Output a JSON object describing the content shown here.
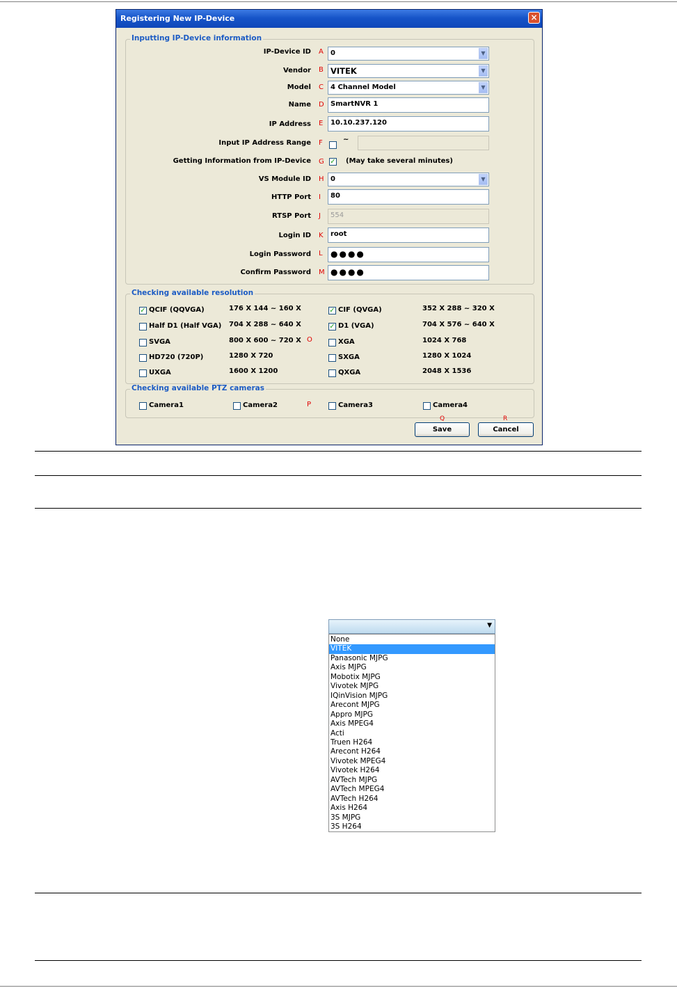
{
  "dialog": {
    "title": "Registering New IP-Device",
    "close_glyph": "×",
    "groups": {
      "info": "Inputting IP-Device information",
      "resolution": "Checking available resolution",
      "ptz": "Checking available PTZ cameras"
    },
    "fields": {
      "device_id": {
        "label": "IP-Device ID",
        "letter": "A",
        "value": "0"
      },
      "vendor": {
        "label": "Vendor",
        "letter": "B",
        "value": "VITEK"
      },
      "model": {
        "label": "Model",
        "letter": "C",
        "value": "4 Channel Model"
      },
      "name": {
        "label": "Name",
        "letter": "D",
        "value": "SmartNVR 1"
      },
      "ip_address": {
        "label": "IP Address",
        "letter": "E",
        "value": "10.10.237.120"
      },
      "ip_range": {
        "label": "Input IP Address Range",
        "letter": "F",
        "separator": "~",
        "value": ""
      },
      "get_info": {
        "label": "Getting Information from IP-Device",
        "letter": "G",
        "note": "(May take several minutes)"
      },
      "vs_module": {
        "label": "VS Module ID",
        "letter": "H",
        "value": "0"
      },
      "http_port": {
        "label": "HTTP Port",
        "letter": "I",
        "value": "80"
      },
      "rtsp_port": {
        "label": "RTSP Port",
        "letter": "J",
        "value": "554"
      },
      "login_id": {
        "label": "Login ID",
        "letter": "K",
        "value": "root"
      },
      "login_password": {
        "label": "Login Password",
        "letter": "L",
        "value": "●●●●"
      },
      "confirm_password": {
        "label": "Confirm Password",
        "letter": "M",
        "value": "●●●●"
      }
    },
    "resolution_letter": "O",
    "resolutions": [
      {
        "label": "QCIF (QQVGA)",
        "size": "176 X 144 ~ 160 X",
        "checked": true
      },
      {
        "label": "CIF (QVGA)",
        "size": "352 X 288 ~ 320 X",
        "checked": true
      },
      {
        "label": "Half D1 (Half VGA)",
        "size": "704 X 288 ~ 640 X",
        "checked": false
      },
      {
        "label": "D1 (VGA)",
        "size": "704 X 576 ~ 640 X",
        "checked": true
      },
      {
        "label": "SVGA",
        "size": "800 X 600 ~ 720 X",
        "checked": false
      },
      {
        "label": "XGA",
        "size": "1024 X 768",
        "checked": false
      },
      {
        "label": "HD720 (720P)",
        "size": "1280 X 720",
        "checked": false
      },
      {
        "label": "SXGA",
        "size": "1280 X 1024",
        "checked": false
      },
      {
        "label": "UXGA",
        "size": "1600 X 1200",
        "checked": false
      },
      {
        "label": "QXGA",
        "size": "2048 X 1536",
        "checked": false
      }
    ],
    "ptz_letter": "P",
    "cameras": [
      "Camera1",
      "Camera2",
      "Camera3",
      "Camera4"
    ],
    "buttons": {
      "save": "Save",
      "save_letter": "Q",
      "cancel": "Cancel",
      "cancel_letter": "R"
    },
    "check_glyph": "✓"
  },
  "vendor_dropdown": {
    "arrow": "▼",
    "selected": "VITEK",
    "options": [
      "None",
      "VITEK",
      "Panasonic MJPG",
      "Axis MJPG",
      "Mobotix MJPG",
      "Vivotek MJPG",
      "IQinVision MJPG",
      "Arecont MJPG",
      "Appro MJPG",
      "Axis MPEG4",
      "Acti",
      "Truen H264",
      "Arecont H264",
      "Vivotek MPEG4",
      "Vivotek H264",
      "AVTech MJPG",
      "AVTech MPEG4",
      "AVTech H264",
      "Axis H264",
      "3S MJPG",
      "3S H264"
    ]
  }
}
